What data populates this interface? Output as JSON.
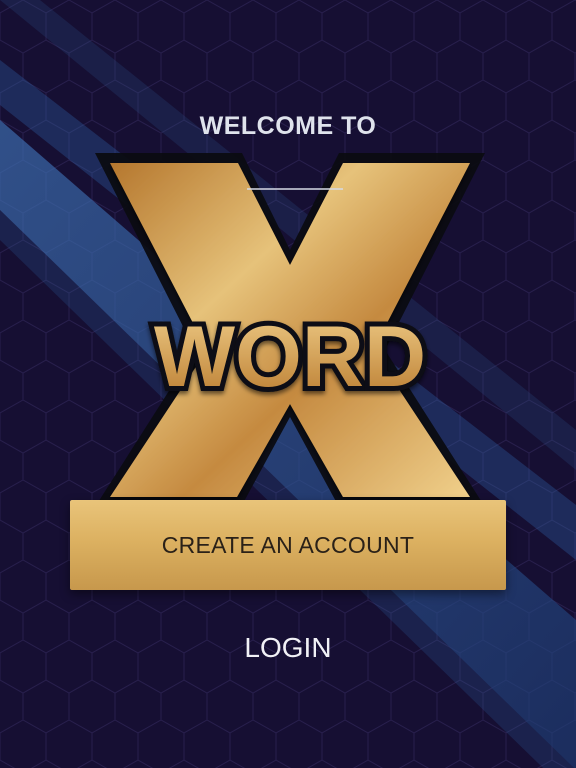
{
  "screen": {
    "welcome_text": "WELCOME TO",
    "logo_letter": "X",
    "logo_word": "WORD",
    "create_account_label": "CREATE AN ACCOUNT",
    "login_label": "LOGIN"
  },
  "colors": {
    "background": "#160f33",
    "stripe": "#2b5c9a",
    "gold": "#d6aa5b"
  }
}
